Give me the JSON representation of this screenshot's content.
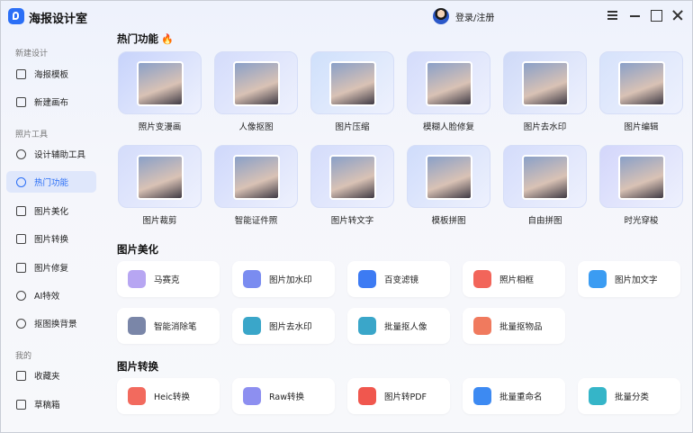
{
  "app": {
    "title": "海报设计室",
    "login": "登录/注册"
  },
  "sidebar": {
    "sections": [
      {
        "title": "新建设计",
        "items": [
          {
            "label": "海报模板",
            "icon": "template-icon"
          },
          {
            "label": "新建画布",
            "icon": "canvas-icon"
          }
        ]
      },
      {
        "title": "照片工具",
        "items": [
          {
            "label": "设计辅助工具",
            "icon": "compass-icon"
          },
          {
            "label": "热门功能",
            "icon": "fire-icon",
            "active": true
          },
          {
            "label": "图片美化",
            "icon": "beautify-icon"
          },
          {
            "label": "图片转换",
            "icon": "convert-icon"
          },
          {
            "label": "图片修复",
            "icon": "repair-icon"
          },
          {
            "label": "AI特效",
            "icon": "ai-icon"
          },
          {
            "label": "抠图换背景",
            "icon": "cutout-icon"
          }
        ]
      },
      {
        "title": "我的",
        "items": [
          {
            "label": "收藏夹",
            "icon": "favorites-icon"
          },
          {
            "label": "草稿箱",
            "icon": "drafts-icon"
          }
        ]
      }
    ]
  },
  "hot": {
    "title": "热门功能",
    "cards": [
      {
        "label": "照片变漫画",
        "tint": "#c7d3fb"
      },
      {
        "label": "人像抠图",
        "tint": "#d4dcfb"
      },
      {
        "label": "图片压缩",
        "tint": "#cfe0fb"
      },
      {
        "label": "模糊人脸修复",
        "tint": "#d4dcfb"
      },
      {
        "label": "图片去水印",
        "tint": "#cfdaf8"
      },
      {
        "label": "图片编辑",
        "tint": "#d6e2fb"
      },
      {
        "label": "图片裁剪",
        "tint": "#d4dcfb"
      },
      {
        "label": "智能证件照",
        "tint": "#cfd8fb"
      },
      {
        "label": "图片转文字",
        "tint": "#d4dcfb"
      },
      {
        "label": "模板拼图",
        "tint": "#cfdcfb"
      },
      {
        "label": "自由拼图",
        "tint": "#d4dcfb"
      },
      {
        "label": "时光穿梭",
        "tint": "#d3d6fb"
      }
    ]
  },
  "beautify": {
    "title": "图片美化",
    "tools": [
      {
        "label": "马赛克",
        "color": "#b7a6f2"
      },
      {
        "label": "图片加水印",
        "color": "#7a8cf0"
      },
      {
        "label": "百变滤镜",
        "color": "#3d7bf3"
      },
      {
        "label": "照片相框",
        "color": "#f2655a"
      },
      {
        "label": "图片加文字",
        "color": "#3b9cf2"
      },
      {
        "label": "智能消除笔",
        "color": "#7a86a8"
      },
      {
        "label": "图片去水印",
        "color": "#3aa6c9"
      },
      {
        "label": "批量抠人像",
        "color": "#3aa6c9"
      },
      {
        "label": "批量抠物品",
        "color": "#f07a5e"
      }
    ]
  },
  "convert": {
    "title": "图片转换",
    "tools": [
      {
        "label": "Heic转换",
        "color": "#f26a5e",
        "badge": "Heic"
      },
      {
        "label": "Raw转换",
        "color": "#8d8ff0",
        "badge": "Raw"
      },
      {
        "label": "图片转PDF",
        "color": "#f0574e",
        "badge": ""
      },
      {
        "label": "批量重命名",
        "color": "#3d8af2",
        "badge": ""
      },
      {
        "label": "批量分类",
        "color": "#35b5c8",
        "badge": ""
      }
    ]
  },
  "colors": {
    "accent": "#2b6ff6",
    "active_bg": "#dfe7fb"
  }
}
